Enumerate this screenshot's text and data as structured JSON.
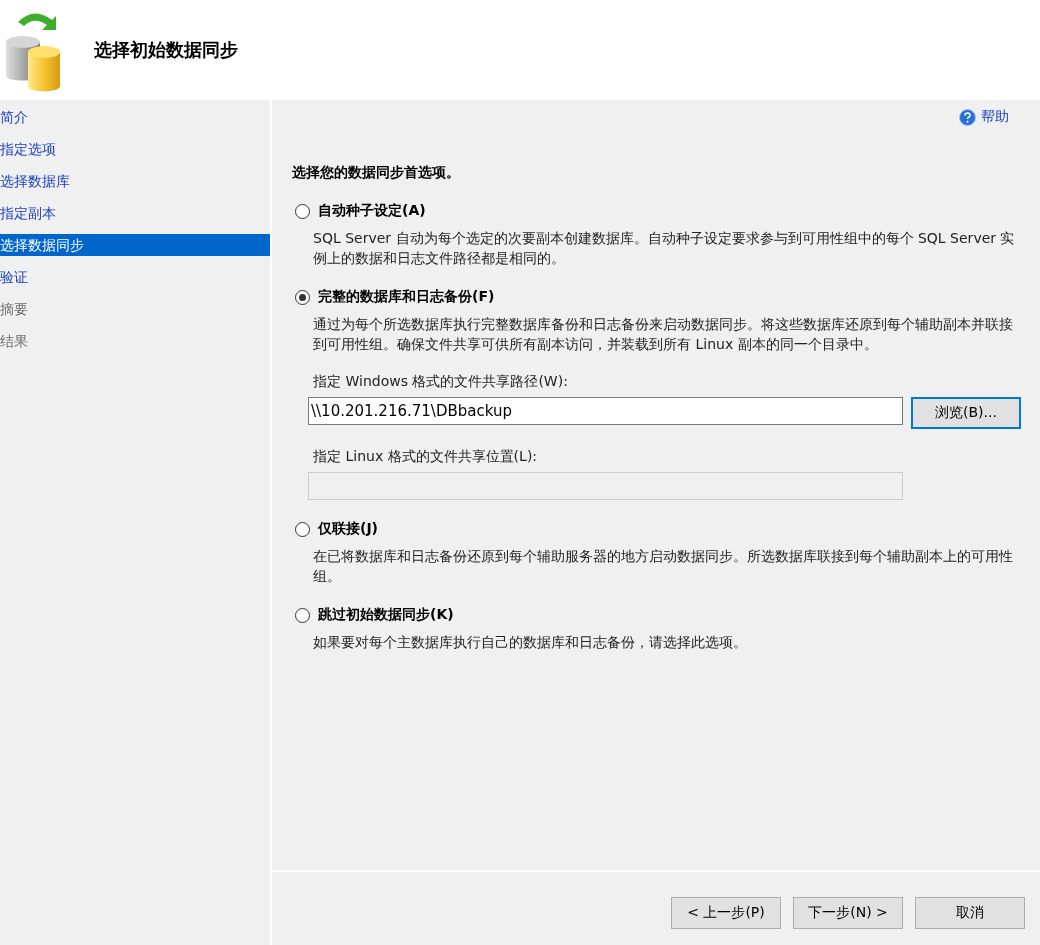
{
  "header": {
    "title": "选择初始数据同步"
  },
  "sidebar": {
    "items": [
      {
        "label": "简介",
        "selected": false,
        "disabled": false
      },
      {
        "label": "指定选项",
        "selected": false,
        "disabled": false
      },
      {
        "label": "选择数据库",
        "selected": false,
        "disabled": false
      },
      {
        "label": "指定副本",
        "selected": false,
        "disabled": false
      },
      {
        "label": "选择数据同步",
        "selected": true,
        "disabled": false
      },
      {
        "label": "验证",
        "selected": false,
        "disabled": false
      },
      {
        "label": "摘要",
        "selected": false,
        "disabled": true
      },
      {
        "label": "结果",
        "selected": false,
        "disabled": true
      }
    ]
  },
  "help": {
    "label": "帮助"
  },
  "prompt": "选择您的数据同步首选项。",
  "options": [
    {
      "label": "自动种子设定(A)",
      "selected": false,
      "description": "SQL Server 自动为每个选定的次要副本创建数据库。自动种子设定要求参与到可用性组中的每个 SQL Server 实例上的数据和日志文件路径都是相同的。"
    },
    {
      "label": "完整的数据库和日志备份(F)",
      "selected": true,
      "description": "通过为每个所选数据库执行完整数据库备份和日志备份来启动数据同步。将这些数据库还原到每个辅助副本并联接到可用性组。确保文件共享可供所有副本访问，并装载到所有 Linux 副本的同一个目录中。",
      "fields": [
        {
          "label": "指定 Windows 格式的文件共享路径(W):",
          "value": "\\\\10.201.216.71\\DBbackup",
          "disabled": false,
          "button": "浏览(B)..."
        },
        {
          "label": "指定 Linux 格式的文件共享位置(L):",
          "disabled": true
        }
      ]
    },
    {
      "label": "仅联接(J)",
      "selected": false,
      "description": "在已将数据库和日志备份还原到每个辅助服务器的地方启动数据同步。所选数据库联接到每个辅助副本上的可用性组。"
    },
    {
      "label": "跳过初始数据同步(K)",
      "selected": false,
      "description": "如果要对每个主数据库执行自己的数据库和日志备份，请选择此选项。"
    }
  ],
  "footer": {
    "buttons": [
      "< 上一步(P)",
      "下一步(N) >",
      "取消"
    ]
  }
}
